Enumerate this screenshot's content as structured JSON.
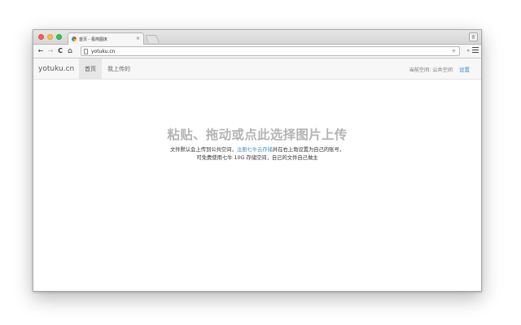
{
  "browser": {
    "tab_title": "首页 - 极简图床",
    "tab_close_glyph": "×",
    "profile_glyph": "言",
    "back_glyph": "←",
    "forward_glyph": "→",
    "reload_glyph": "C",
    "home_glyph": "⌂",
    "url": "yotuku.cn",
    "star_glyph": "★",
    "extensions_glyph": "»"
  },
  "site": {
    "brand": "yotuku.cn",
    "nav": [
      {
        "label": "首页",
        "active": true
      },
      {
        "label": "我上传的",
        "active": false
      }
    ],
    "current_space": "当前空间: 公共空间",
    "settings_label": "设置"
  },
  "main": {
    "headline": "粘贴、拖动或点此选择图片上传",
    "desc_line1_prefix": "文件默认会上传到公共空间，",
    "desc_link": "注册七牛云存储",
    "desc_line1_suffix": "并在右上角设置为自己的账号，",
    "desc_line2": "可免费使用七牛 10G 存储空间，自己的文件自己做主"
  },
  "colors": {
    "link": "#428bca",
    "headline": "#b4b4b4",
    "close_dot": "#fc605c",
    "minimize_dot": "#fdbc40",
    "zoom_dot": "#34c84a"
  }
}
